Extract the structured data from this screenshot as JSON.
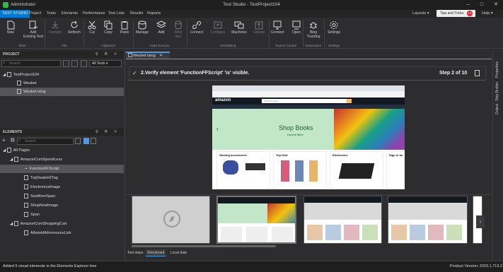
{
  "window": {
    "title": "Test Studio - TestProject104",
    "user": "Administrator"
  },
  "menu": [
    "TEST STUDIO",
    "Project",
    "Tests",
    "Elements",
    "Performance",
    "Test Lists",
    "Results",
    "Reports"
  ],
  "layouts_label": "Layouts",
  "tips_label": "Tips and Tricks",
  "tips_count": "12",
  "help_label": "Help",
  "ribbon": {
    "buttons": [
      "New",
      "Add\nExisting Test",
      "Compile",
      "Refresh",
      "Cut",
      "Copy",
      "Paste",
      "Manage",
      "Add",
      "Bind\ntest",
      "Connect",
      "Configure",
      "Machines",
      "Upload",
      "Connect",
      "Open",
      "Blog\nTracking",
      "Settings"
    ],
    "groups": [
      "Tests",
      "File",
      "Clipboard",
      "Data Sources",
      "Scheduling",
      "Source Control",
      "Extensions",
      "Settings"
    ]
  },
  "project": {
    "header": "PROJECT",
    "search_placeholder": "Search",
    "filter": "All Tests",
    "items": [
      "TestProject104",
      "Wesbet",
      "Wesbet tslog"
    ]
  },
  "elements": {
    "header": "ELEMENTS",
    "search_placeholder": "Search",
    "items": [
      "All Pages",
      "AmazonComSpendLess",
      "FunctionFFScript",
      "TopDealsH2Tag",
      "ElectronicsImage",
      "SeeMoreSpan",
      "ShopNowImage",
      "Span",
      "AmazonComShoppingCart",
      "AAutoidAAnnounceLink"
    ]
  },
  "document_tab": "Wesbet tslog",
  "step": {
    "text": "2.Verify element 'FunctionFFScript' 'is' visible.",
    "counter": "Step 2 of 10"
  },
  "amazon": {
    "logo": "amazon",
    "search": "Search Amazon",
    "hero_title": "Shop Books",
    "hero_sub": "explore titles",
    "cards": [
      "Gaming accessories",
      "Top Deal",
      "Electronics",
      "Sign in for"
    ]
  },
  "bottom_tabs": [
    "Test steps",
    "Storyboard",
    "Local data"
  ],
  "side_tabs": [
    "Properties",
    "Step Builder",
    "Output"
  ],
  "status": {
    "left": "Added 9 visual elements in the Elements Explorer tree",
    "right": "Product Version: 2023.1.713.2"
  }
}
